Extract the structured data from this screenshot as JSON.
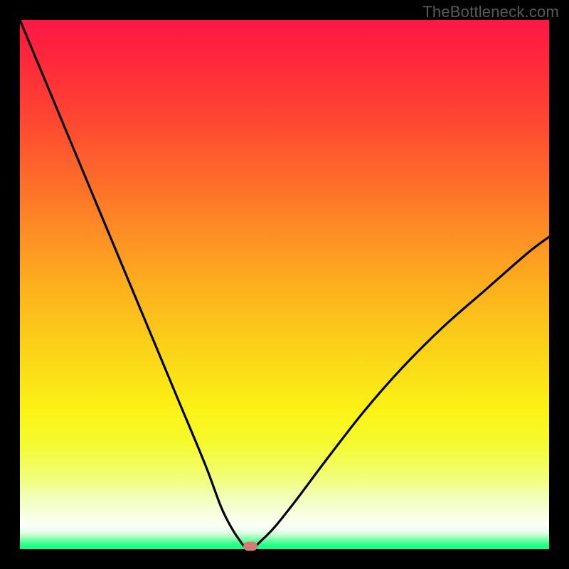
{
  "watermark": "TheBottleneck.com",
  "chart_data": {
    "type": "line",
    "title": "",
    "xlabel": "",
    "ylabel": "",
    "xlim": [
      0,
      100
    ],
    "ylim": [
      0,
      100
    ],
    "grid": false,
    "series": [
      {
        "name": "bottleneck-curve",
        "x": [
          0,
          5,
          10,
          15,
          20,
          25,
          30,
          35,
          38,
          40,
          42,
          43,
          44,
          45,
          48,
          52,
          58,
          65,
          72,
          80,
          88,
          96,
          100
        ],
        "values": [
          100,
          88,
          76,
          64,
          52,
          40,
          28,
          16,
          8,
          4,
          1,
          0,
          0,
          1,
          4,
          9,
          17,
          26,
          34,
          42,
          49,
          56,
          59
        ]
      }
    ],
    "marker": {
      "x": 43.5,
      "y": 0.5
    },
    "gradient_stops": [
      {
        "pct": 0,
        "color": "#fe1849"
      },
      {
        "pct": 50,
        "color": "#fcae1e"
      },
      {
        "pct": 80,
        "color": "#f5fb2f"
      },
      {
        "pct": 95,
        "color": "#fdfff8"
      },
      {
        "pct": 100,
        "color": "#16ff81"
      }
    ]
  }
}
